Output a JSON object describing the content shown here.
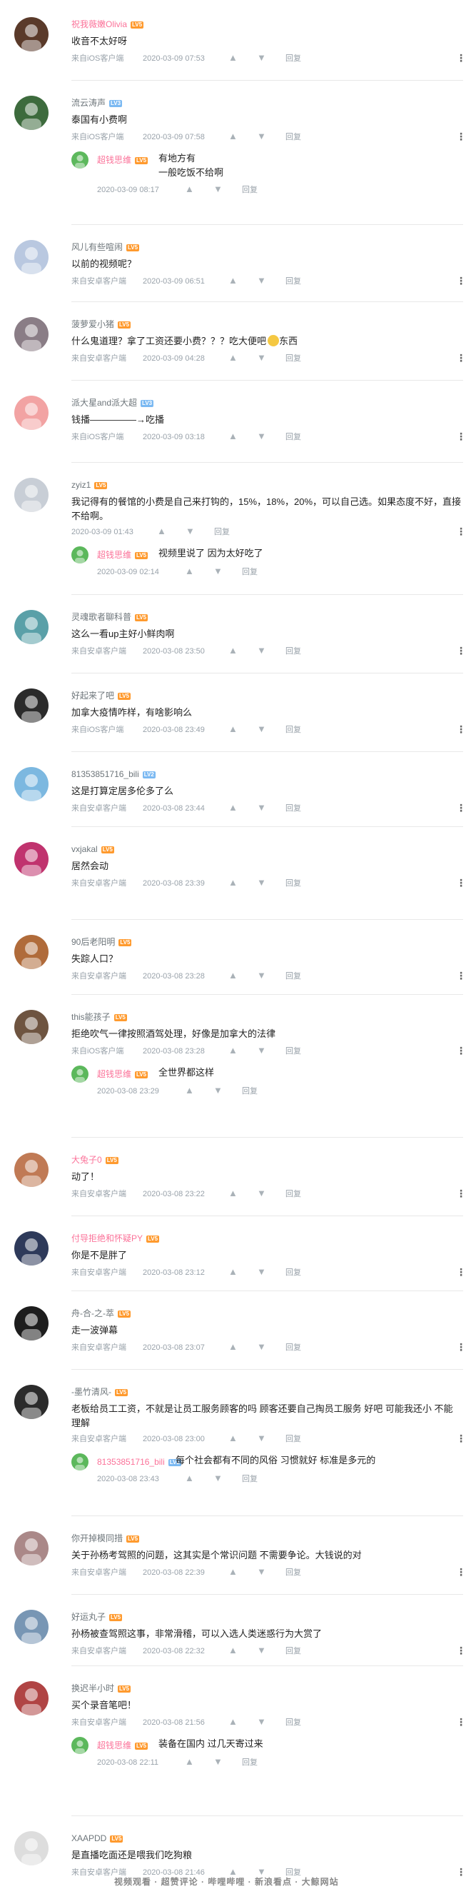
{
  "ui": {
    "more_icon": "ellipsis-vertical-icon",
    "like_icon": "thumb-up-icon",
    "dislike_icon": "thumb-down-icon",
    "reply_label": "回复"
  },
  "comments": [
    {
      "user": "祝我薇嫩Olivia",
      "vip": true,
      "lv": "LV5",
      "text": "收音不太好呀",
      "src": "来自iOS客户端",
      "time": "2020-03-09 07:53"
    },
    {
      "user": "流云涛声",
      "vip": false,
      "lv": "LV3",
      "text": "泰国有小费啊",
      "src": "来自iOS客户端",
      "time": "2020-03-09 07:58",
      "reply": {
        "user": "超钱思维",
        "lv": "LV5",
        "text": "有地方有",
        "text2": "一般吃饭不给啊",
        "time": "2020-03-09 08:17"
      }
    },
    {
      "user": "风儿有些喧闹",
      "vip": false,
      "lv": "LV5",
      "text": "以前的视频呢？",
      "src": "来自安卓客户端",
      "time": "2020-03-09 06:51"
    },
    {
      "user": "菠萝爱小猪",
      "vip": false,
      "lv": "LV5",
      "text": "什么鬼道理？拿了工资还要小费？？？吃大便吧",
      "text_after": "东西",
      "src": "来自安卓客户端",
      "time": "2020-03-09 04:28"
    },
    {
      "user": "派大星and派大超",
      "vip": false,
      "lv": "LV3",
      "text": "钱播—————→吃播",
      "src": "来自iOS客户端",
      "time": "2020-03-09 03:18"
    },
    {
      "user": "zyiz1",
      "vip": false,
      "lv": "LV5",
      "text": "我记得有的餐馆的小费是自己来打钩的，15%，18%，20%，可以自己选。如果态度不好，直接不给啊。",
      "src": "",
      "time": "2020-03-09 01:43",
      "reply": {
        "user": "超钱思维",
        "lv": "LV5",
        "text": "视频里说了 因为太好吃了",
        "text2": "",
        "time": "2020-03-09 02:14"
      }
    },
    {
      "user": "灵魂歌者聊科普",
      "vip": false,
      "lv": "LV5",
      "text": "这么一看up主好小鲜肉啊",
      "src": "来自安卓客户端",
      "time": "2020-03-08 23:50"
    },
    {
      "user": "好起来了吧",
      "vip": false,
      "lv": "LV5",
      "text": "加拿大疫情咋样，有啥影响么",
      "src": "来自iOS客户端",
      "time": "2020-03-08 23:49"
    },
    {
      "user": "81353851716_bili",
      "vip": false,
      "lv": "LV2",
      "text": "这是打算定居多伦多了么",
      "src": "来自安卓客户端",
      "time": "2020-03-08 23:44"
    },
    {
      "user": "vxjakal",
      "vip": false,
      "lv": "LV5",
      "text": "居然会动",
      "src": "来自安卓客户端",
      "time": "2020-03-08 23:39"
    },
    {
      "user": "90后老阳明",
      "vip": false,
      "lv": "LV5",
      "text": "失踪人口？",
      "src": "来自安卓客户端",
      "time": "2020-03-08 23:28"
    },
    {
      "user": "this能孩子",
      "vip": false,
      "lv": "LV5",
      "text": "拒绝吹气一律按照酒驾处理，好像是加拿大的法律",
      "src": "来自iOS客户端",
      "time": "2020-03-08 23:28",
      "reply": {
        "user": "超钱思维",
        "lv": "LV5",
        "text": "全世界都这样",
        "text2": "",
        "time": "2020-03-08 23:29"
      }
    },
    {
      "user": "大兔子0",
      "vip": true,
      "lv": "LV5",
      "text": "动了！",
      "src": "来自安卓客户端",
      "time": "2020-03-08 23:22"
    },
    {
      "user": "付导拒绝和怀疑PY",
      "vip": true,
      "lv": "LV5",
      "text": "你是不是胖了",
      "src": "来自安卓客户端",
      "time": "2020-03-08 23:12"
    },
    {
      "user": "舟-合-之-萃",
      "vip": false,
      "lv": "LV5",
      "text": "走一波弹幕",
      "src": "来自安卓客户端",
      "time": "2020-03-08 23:07"
    },
    {
      "user": "-墨竹清风-",
      "vip": false,
      "lv": "LV5",
      "text": "老板给员工工资，不就是让员工服务顾客的吗 顾客还要自己掏员工服务 好吧 可能我还小 不能理解",
      "src": "来自安卓客户端",
      "time": "2020-03-08 23:00",
      "reply": {
        "user": "81353851716_bili",
        "lv": "LV2",
        "text": "每个社会都有不同的风俗 习惯就好 标准是多元的",
        "text2": "",
        "time": "2020-03-08 23:43"
      }
    },
    {
      "user": "你开掉模同措",
      "vip": false,
      "lv": "LV5",
      "text": "关于孙杨考驾照的问题，这其实是个常识问题 不需要争论。大钱说的对",
      "src": "来自安卓客户端",
      "time": "2020-03-08 22:39"
    },
    {
      "user": "好运丸子",
      "vip": false,
      "lv": "LV5",
      "text": "孙杨被查驾照这事，非常滑稽，可以入选人类迷惑行为大赏了",
      "src": "来自安卓客户端",
      "time": "2020-03-08 22:32"
    },
    {
      "user": "换迟半小时",
      "vip": false,
      "lv": "LV5",
      "text": "买个录音笔吧！",
      "src": "来自安卓客户端",
      "time": "2020-03-08 21:56",
      "reply": {
        "user": "超钱思维",
        "lv": "LV5",
        "text": "装备在国内 过几天寄过来",
        "text2": "",
        "time": "2020-03-08 22:11"
      }
    },
    {
      "user": "XAAPDD",
      "vip": false,
      "lv": "LV5",
      "text": "是直播吃面还是喂我们吃狗粮",
      "src": "来自安卓客户端",
      "time": "2020-03-08 21:46"
    }
  ],
  "watermark": "视频观看 · 超赞评论 · 哔哩哔哩 · 新浪看点 · 大鲸网站"
}
